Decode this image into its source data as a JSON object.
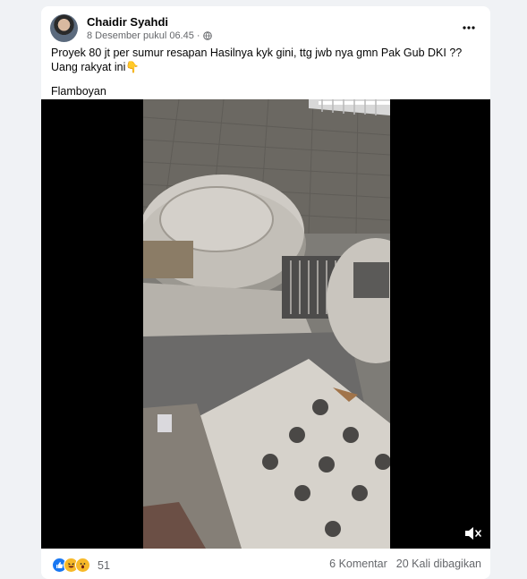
{
  "post": {
    "author": "Chaidir Syahdi",
    "timestamp": "8 Desember pukul 06.45",
    "separator": "·",
    "privacy_icon": "globe-icon",
    "more_icon": "more-horizontal-icon",
    "text": "Proyek 80 jt per sumur resapan Hasilnya kyk gini, ttg jwb nya gmn Pak Gub DKI ?? Uang rakyat ini👇",
    "location": "Flamboyan"
  },
  "video": {
    "mute_icon": "volume-muted-icon"
  },
  "footer": {
    "reaction_icons": [
      "like-icon",
      "haha-icon",
      "wow-icon"
    ],
    "reaction_count": "51",
    "comments": "6 Komentar",
    "shares": "20 Kali dibagikan"
  },
  "colors": {
    "page_bg": "#f0f2f5",
    "card_bg": "#ffffff",
    "secondary_text": "#65676b",
    "like_blue": "#1877f2",
    "reaction_yellow": "#f7b928"
  }
}
